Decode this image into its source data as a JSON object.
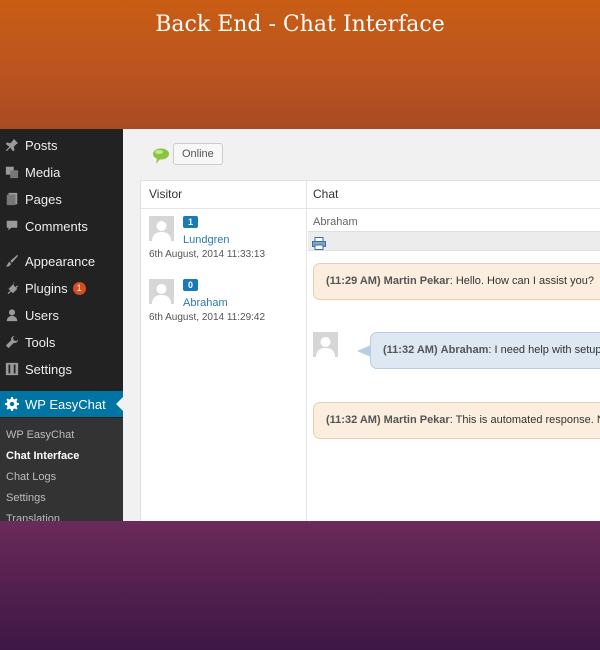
{
  "banner": {
    "title": "Back End - Chat Interface"
  },
  "sidebar": {
    "items": [
      {
        "label": "Posts",
        "icon": "pin-icon"
      },
      {
        "label": "Media",
        "icon": "media-icon"
      },
      {
        "label": "Pages",
        "icon": "pages-icon"
      },
      {
        "label": "Comments",
        "icon": "comment-icon"
      },
      {
        "label": "Appearance",
        "icon": "brush-icon"
      },
      {
        "label": "Plugins",
        "icon": "plug-icon",
        "badge": "1"
      },
      {
        "label": "Users",
        "icon": "user-icon"
      },
      {
        "label": "Tools",
        "icon": "wrench-icon"
      },
      {
        "label": "Settings",
        "icon": "settings-icon"
      },
      {
        "label": "WP EasyChat",
        "icon": "gear-icon",
        "active": true
      }
    ],
    "submenu": [
      "WP EasyChat",
      "Chat Interface",
      "Chat Logs",
      "Settings",
      "Translation"
    ],
    "current_submenu": "Chat Interface"
  },
  "toolbar": {
    "status_button": "Online"
  },
  "columns": {
    "visitor": "Visitor",
    "chat": "Chat"
  },
  "visitors": [
    {
      "badge": "1",
      "name": "Lundgren",
      "time": "6th August, 2014 11:33:13"
    },
    {
      "badge": "0",
      "name": "Abraham",
      "time": "6th August, 2014 11:29:42"
    }
  ],
  "chat": {
    "visitor_name": "Abraham",
    "messages": [
      {
        "time": "(11:29 AM)",
        "author": "Martin Pekar",
        "text": ": Hello. How can I assist you?",
        "type": "operator"
      },
      {
        "time": "(11:32 AM)",
        "author": "Abraham",
        "text": ": I need help with setup",
        "type": "visitor"
      },
      {
        "time": "(11:32 AM)",
        "author": "Martin Pekar",
        "text": ": This is automated response. No live",
        "type": "operator"
      }
    ]
  },
  "colors": {
    "banner_top": "#c95d14",
    "banner_bottom": "#4a1a4e",
    "sidebar_bg": "#222222",
    "active_menu": "#0074a2",
    "badge_blue": "#1a7ab3",
    "operator_bubble": "#fbeedf",
    "visitor_bubble": "#dde8f2"
  }
}
